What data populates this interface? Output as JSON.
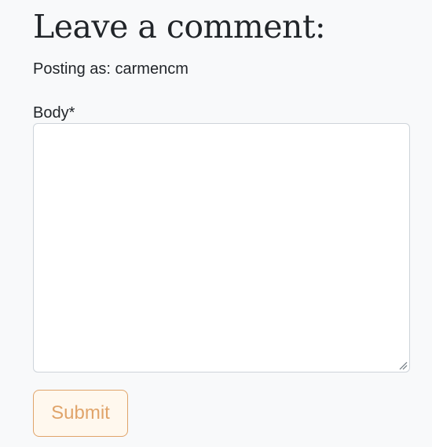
{
  "comment_form": {
    "heading": "Leave a comment:",
    "posting_as": "Posting as: carmencm",
    "body_label": "Body*",
    "body_value": "",
    "submit_label": "Submit"
  },
  "colors": {
    "page_background": "#f8f9fa",
    "text": "#212529",
    "input_border": "#ced4da",
    "submit_accent": "#e0a46a",
    "submit_background": "#fff8ee"
  },
  "icons": {
    "textarea_resize": "resize-grip-icon"
  }
}
